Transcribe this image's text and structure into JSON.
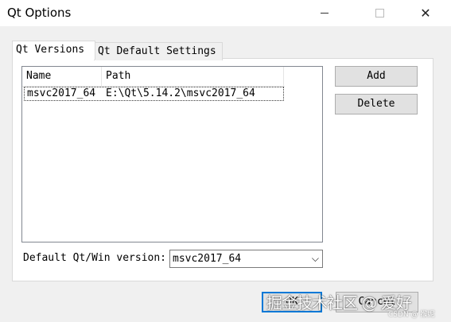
{
  "window": {
    "title": "Qt Options",
    "minimize_glyph": "",
    "close_glyph": "✕"
  },
  "tabs": [
    {
      "label": "Qt Versions",
      "active": true
    },
    {
      "label": "Qt Default Settings",
      "active": false
    }
  ],
  "versions_table": {
    "columns": [
      "Name",
      "Path"
    ],
    "rows": [
      {
        "name": "msvc2017_64",
        "path": "E:\\Qt\\5.14.2\\msvc2017_64"
      }
    ]
  },
  "buttons": {
    "add": "Add",
    "delete": "Delete",
    "ok": "OK",
    "cancel": "Cancel"
  },
  "default_version": {
    "label": "Default Qt/Win version:",
    "selected": "msvc2017_64",
    "arrow_glyph": "⌵"
  },
  "watermark": {
    "text": "掘金技术社区 @ 爱好",
    "sub": "CSDN @ 猴妮"
  },
  "colors": {
    "focus_border": "#0078d7",
    "button_bg": "#e1e1e1",
    "dialog_bg": "#f0f0f0"
  }
}
